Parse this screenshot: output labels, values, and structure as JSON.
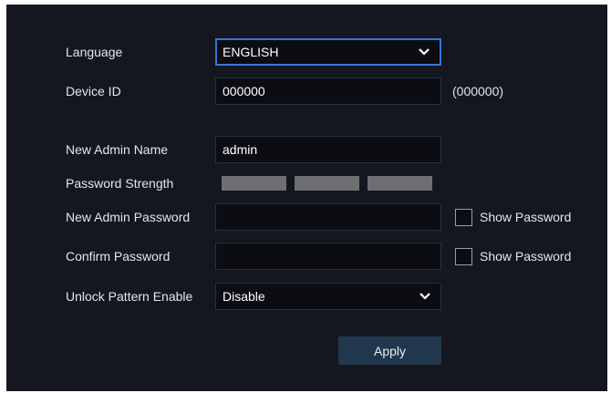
{
  "language": {
    "label": "Language",
    "value": "ENGLISH"
  },
  "device_id": {
    "label": "Device ID",
    "value": "000000",
    "hint": "(000000)"
  },
  "admin_name": {
    "label": "New Admin Name",
    "value": "admin"
  },
  "password_strength": {
    "label": "Password Strength",
    "level": 0,
    "segments": 3
  },
  "admin_password": {
    "label": "New Admin Password",
    "value": "",
    "show_label": "Show Password"
  },
  "confirm_password": {
    "label": "Confirm Password",
    "value": "",
    "show_label": "Show Password"
  },
  "unlock_pattern": {
    "label": "Unlock Pattern Enable",
    "value": "Disable"
  },
  "apply_label": "Apply",
  "colors": {
    "panel_bg": "#14171f",
    "field_bg": "#0b0d13",
    "focus_border": "#3b74d8",
    "strength_empty": "#6e6f72",
    "button_bg": "#20374d"
  },
  "icons": {
    "dropdown": "chevron-down-icon"
  }
}
